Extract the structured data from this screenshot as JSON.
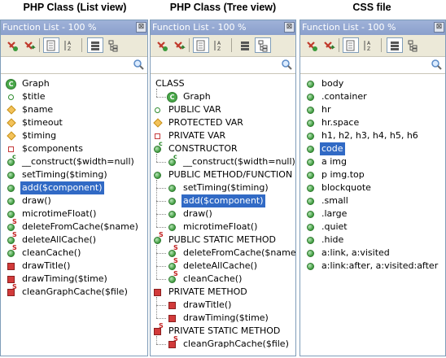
{
  "headers": {
    "list_view": "PHP Class (List view)",
    "tree_view": "PHP Class (Tree view)",
    "css_file": "CSS file"
  },
  "panel": {
    "title": "Function List - 100 %",
    "close_glyph": "⊠"
  },
  "colors": {
    "titlebar": "#8aa0cc",
    "selection": "#316ac5",
    "toolbar": "#ece9d8"
  },
  "list_view": {
    "items": [
      {
        "icon": "class-icon",
        "label": "Graph"
      },
      {
        "icon": "public-var-icon",
        "label": "$title"
      },
      {
        "icon": "protected-var-icon",
        "label": "$name"
      },
      {
        "icon": "protected-var-icon",
        "label": "$timeout"
      },
      {
        "icon": "protected-var-icon",
        "label": "$timing"
      },
      {
        "icon": "private-var-icon",
        "label": "$components"
      },
      {
        "icon": "constructor-icon",
        "label": "__construct($width=null)"
      },
      {
        "icon": "public-method-icon",
        "label": "setTiming($timing)"
      },
      {
        "icon": "public-method-icon",
        "label": "add($component)",
        "selected": true
      },
      {
        "icon": "public-method-icon",
        "label": "draw()"
      },
      {
        "icon": "public-method-icon",
        "label": "microtimeFloat()"
      },
      {
        "icon": "public-static-method-icon",
        "label": "deleteFromCache($name)"
      },
      {
        "icon": "public-static-method-icon",
        "label": "deleteAllCache()"
      },
      {
        "icon": "public-static-method-icon",
        "label": "cleanCache()"
      },
      {
        "icon": "private-method-icon",
        "label": "drawTitle()"
      },
      {
        "icon": "private-method-icon",
        "label": "drawTiming($time)"
      },
      {
        "icon": "private-static-method-icon",
        "label": "cleanGraphCache($file)"
      }
    ]
  },
  "tree_view": {
    "items": [
      {
        "icon": "none",
        "label": "CLASS",
        "depth": 0
      },
      {
        "icon": "class-icon",
        "label": "Graph",
        "depth": 1
      },
      {
        "icon": "public-var-icon",
        "label": "PUBLIC VAR",
        "depth": 0
      },
      {
        "icon": "protected-var-icon",
        "label": "PROTECTED VAR",
        "depth": 0
      },
      {
        "icon": "private-var-icon",
        "label": "PRIVATE VAR",
        "depth": 0
      },
      {
        "icon": "constructor-icon",
        "label": "CONSTRUCTOR",
        "depth": 0
      },
      {
        "icon": "constructor-icon",
        "label": "__construct($width=null)",
        "depth": 1
      },
      {
        "icon": "public-method-icon",
        "label": "PUBLIC METHOD/FUNCTION",
        "depth": 0
      },
      {
        "icon": "public-method-icon",
        "label": "setTiming($timing)",
        "depth": 1
      },
      {
        "icon": "public-method-icon",
        "label": "add($component)",
        "depth": 1,
        "selected": true
      },
      {
        "icon": "public-method-icon",
        "label": "draw()",
        "depth": 1
      },
      {
        "icon": "public-method-icon",
        "label": "microtimeFloat()",
        "depth": 1
      },
      {
        "icon": "public-static-method-icon",
        "label": "PUBLIC STATIC METHOD",
        "depth": 0
      },
      {
        "icon": "public-static-method-icon",
        "label": "deleteFromCache($name)",
        "depth": 1
      },
      {
        "icon": "public-static-method-icon",
        "label": "deleteAllCache()",
        "depth": 1
      },
      {
        "icon": "public-static-method-icon",
        "label": "cleanCache()",
        "depth": 1
      },
      {
        "icon": "private-method-icon",
        "label": "PRIVATE METHOD",
        "depth": 0
      },
      {
        "icon": "private-method-icon",
        "label": "drawTitle()",
        "depth": 1
      },
      {
        "icon": "private-method-icon",
        "label": "drawTiming($time)",
        "depth": 1
      },
      {
        "icon": "private-static-method-icon",
        "label": "PRIVATE STATIC METHOD",
        "depth": 0
      },
      {
        "icon": "private-static-method-icon",
        "label": "cleanGraphCache($file)",
        "depth": 1
      }
    ]
  },
  "css_view": {
    "items": [
      {
        "icon": "selector-icon",
        "label": "body"
      },
      {
        "icon": "selector-icon",
        "label": ".container"
      },
      {
        "icon": "selector-icon",
        "label": "hr"
      },
      {
        "icon": "selector-icon",
        "label": "hr.space"
      },
      {
        "icon": "selector-icon",
        "label": "h1, h2, h3, h4, h5, h6"
      },
      {
        "icon": "selector-icon",
        "label": "code",
        "selected": true
      },
      {
        "icon": "selector-icon",
        "label": "a img"
      },
      {
        "icon": "selector-icon",
        "label": "p img.top"
      },
      {
        "icon": "selector-icon",
        "label": "blockquote"
      },
      {
        "icon": "selector-icon",
        "label": ".small"
      },
      {
        "icon": "selector-icon",
        "label": ".large"
      },
      {
        "icon": "selector-icon",
        "label": ".quiet"
      },
      {
        "icon": "selector-icon",
        "label": ".hide"
      },
      {
        "icon": "selector-icon",
        "label": "a:link, a:visited"
      },
      {
        "icon": "selector-icon",
        "label": "a:link:after, a:visited:after"
      }
    ]
  }
}
